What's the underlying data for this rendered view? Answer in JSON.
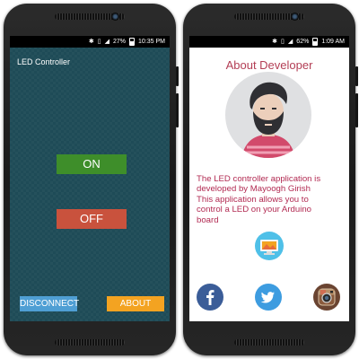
{
  "left_phone": {
    "status_bar": {
      "battery": "27%",
      "time": "10:35 PM"
    },
    "app_title": "LED Controller",
    "buttons": {
      "on": "ON",
      "off": "OFF",
      "disconnect": "DISCONNECT",
      "about": "ABOUT"
    },
    "colors": {
      "background": "#1e4b57",
      "on": "#3e8e2a",
      "off": "#c9523d",
      "disconnect": "#4f9fd4",
      "about": "#f3a321"
    }
  },
  "right_phone": {
    "status_bar": {
      "battery": "62%",
      "time": "1:09 AM"
    },
    "title": "About Developer",
    "description_lines": [
      "The LED controller application is",
      "developed by Mayoogh Girish",
      "This application allows you to",
      "control a LED on your Arduino",
      "board"
    ],
    "icons": [
      "developer-avatar",
      "tv-icon",
      "facebook-icon",
      "twitter-icon",
      "instagram-icon"
    ],
    "colors": {
      "accent": "#b22a52",
      "facebook": "#3b5d98",
      "twitter": "#3d9ce0",
      "instagram": "#6a4431"
    }
  }
}
